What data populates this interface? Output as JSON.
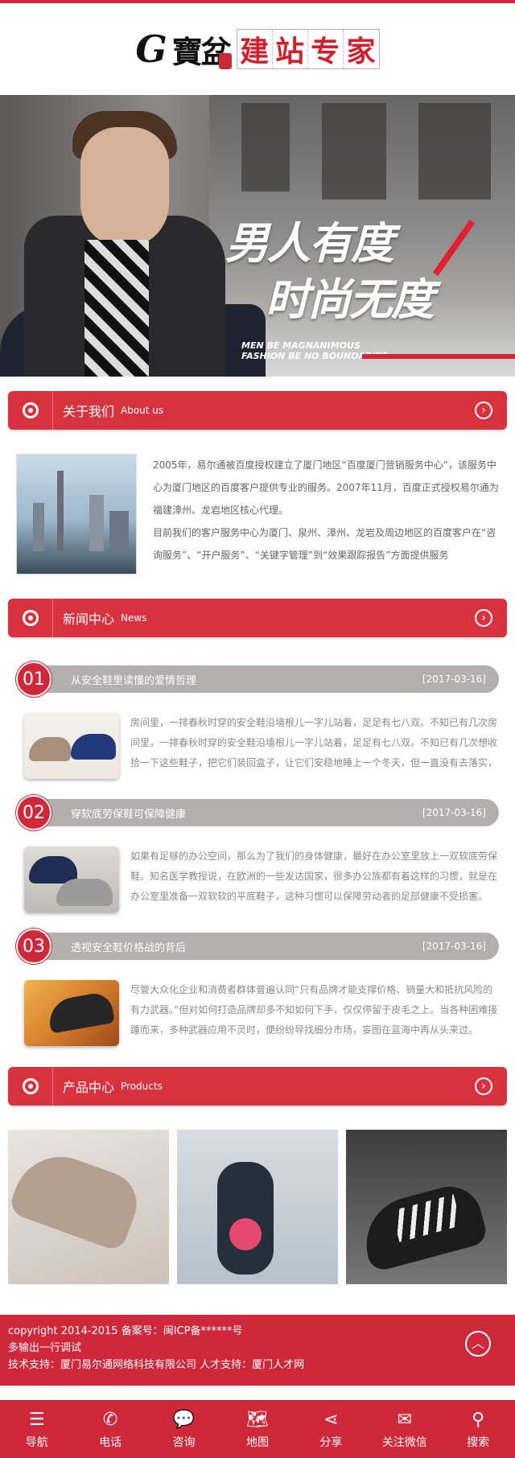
{
  "logo": {
    "g_letter": "G",
    "brand_cn": "寶盆",
    "tagline_chars": [
      "建",
      "站",
      "专",
      "家"
    ]
  },
  "banner": {
    "slogan_line1": "男人有度",
    "slogan_line2": "时尚无度",
    "en_line1": "MEN BE MAGNANIMOUS",
    "en_line2": "FASHION BE NO BOUNDARIES"
  },
  "sections": {
    "about": {
      "title": "关于我们",
      "sub": "About us"
    },
    "news": {
      "title": "新闻中心",
      "sub": "News"
    },
    "products": {
      "title": "产品中心",
      "sub": "Products"
    }
  },
  "about": {
    "paragraph1": "2005年，易尔通被百度授权建立了厦门地区“百度厦门营销服务中心”，该服务中心为厦门地区的百度客户提供专业的服务。2007年11月，百度正式授权易尔通为福建漳州、龙岩地区核心代理。",
    "paragraph2": "目前我们的客户服务中心为厦门、泉州、漳州、龙岩及周边地区的百度客户在“咨询服务”、“开户服务”、“关键字管理”到“效果跟踪报告”方面提供服务"
  },
  "news": [
    {
      "num": "01",
      "title": "从安全鞋里读懂的爱情哲理",
      "date": "[2017-03-16]",
      "text": "房间里，一排春秋时穿的安全鞋沿墙根儿一字儿站着，足足有七八双。不知已有几次房间里，一排春秋时穿的安全鞋沿墙根儿一字儿站着，足足有七八双。不知已有几次想收拾一下这些鞋子，把它们装回盒子，让它们安稳地睡上一个冬天，但一直没有去落实，"
    },
    {
      "num": "02",
      "title": "穿软底劳保鞋可保障健康",
      "date": "[2017-03-16]",
      "text": "如果有足够的办公空间，那么为了我们的身体健康，最好在办公室里放上一双软底劳保鞋。知名医学教授说，在欧洲的一些发达国家，很多办公族都有着这样的习惯，就是在办公室里准备一双软软的平底鞋子，这种习惯可以保障劳动者的足部健康不受损害。"
    },
    {
      "num": "03",
      "title": "透视安全鞋价格战的背后",
      "date": "[2017-03-16]",
      "text": "尽管大众化企业和消费者群体普遍认同“只有品牌才能支撑价格、销量大和抵抗风险的有力武器。”但对如何打造品牌却多不知如何下手，仅仅停留于皮毛之上。当各种困难接踵而来，多种武器应用不灵时，便纷纷导找细分市场，妄图在蓝海中再从头来过。"
    }
  ],
  "footer": {
    "line1": "copyright 2014-2015 备案号：闽ICP备******号",
    "line2": "多输出一行调试",
    "line3": "技术支持：厦门易尔通网络科技有限公司 人才支持：厦门人才网",
    "up_glyph": "︿"
  },
  "bottom_nav": [
    {
      "label": "导航",
      "icon": "☰"
    },
    {
      "label": "电话",
      "icon": "✆"
    },
    {
      "label": "咨询",
      "icon": "💬"
    },
    {
      "label": "地图",
      "icon": "🗺"
    },
    {
      "label": "分享",
      "icon": "⋖"
    },
    {
      "label": "关注微信",
      "icon": "✉"
    },
    {
      "label": "搜索",
      "icon": "⚲"
    }
  ],
  "colors": {
    "brand_red": "#d0283b",
    "news_bar_gray": "#b3afae"
  }
}
